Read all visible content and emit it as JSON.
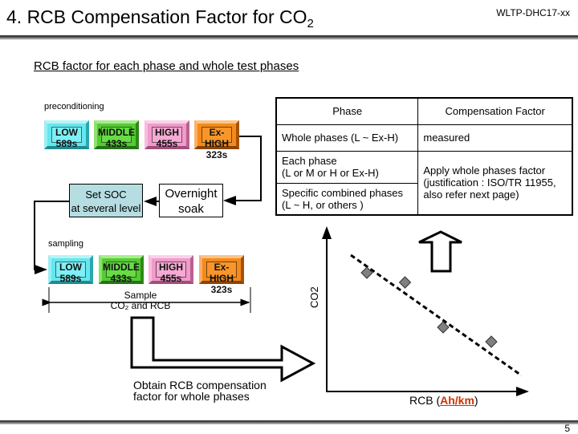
{
  "header": {
    "title": "4. RCB Compensation Factor for CO",
    "title_subscript": "2",
    "doc_id": "WLTP-DHC17-xx"
  },
  "subtitle": "RCB factor for each phase and whole test phases",
  "flow": {
    "preconditioning_label": "preconditioning",
    "sampling_label": "sampling",
    "phases": [
      {
        "name": "LOW",
        "duration": "589s",
        "color": "#66e6ee"
      },
      {
        "name": "MIDDLE",
        "duration": "433s",
        "color": "#55cc33"
      },
      {
        "name": "HIGH",
        "duration": "455s",
        "color": "#f29acb"
      },
      {
        "name": "Ex-HIGH",
        "duration": "323s",
        "color": "#f58a1a"
      }
    ],
    "set_soc": {
      "line1": "Set SOC",
      "line2": "at several level"
    },
    "overnight_soak": {
      "line1": "Overnight",
      "line2": "soak"
    },
    "sample_label_line1": "Sample",
    "sample_label_line2": "CO₂ and RCB",
    "obtain_label_line1": "Obtain RCB compensation",
    "obtain_label_line2": "factor for whole phases"
  },
  "table": {
    "headers": [
      "Phase",
      "Compensation Factor"
    ],
    "rows": [
      {
        "phase": "Whole phases (L ~ Ex-H)",
        "factor": "measured"
      },
      {
        "phase_line1": "Each phase",
        "phase_line2": "(L or M or H or Ex-H)"
      },
      {
        "phase_line1": "Specific combined phases",
        "phase_line2": "(L ~ H, or others )"
      }
    ],
    "shared_factor_line1": "Apply whole phases factor",
    "shared_factor_line2": "(justification : ISO/TR 11955,",
    "shared_factor_line3": "also refer next page)"
  },
  "scatter": {
    "ylabel": "CO2",
    "xlabel_prefix": "RCB (",
    "xlabel_unit": "Ah/km",
    "xlabel_suffix": ")",
    "unit_color": "#cc3300",
    "points": [
      [
        0.2,
        0.74
      ],
      [
        0.39,
        0.68
      ],
      [
        0.58,
        0.4
      ],
      [
        0.82,
        0.31
      ]
    ],
    "trend": [
      [
        0.12,
        0.85
      ],
      [
        0.97,
        0.1
      ]
    ]
  },
  "footer": {
    "page_number": "5"
  }
}
